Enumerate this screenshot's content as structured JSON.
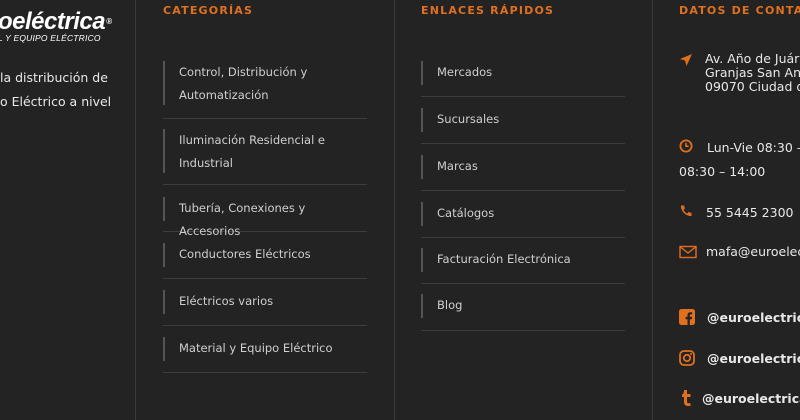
{
  "brand": {
    "logo_text": "oeléctrica",
    "logo_mark": "®",
    "tagline": "L Y EQUIPO ELÉCTRICO",
    "description": "la distribución de o Eléctrico a nivel"
  },
  "categories": {
    "heading": "CATEGORÍAS",
    "items": [
      {
        "label": "Control, Distribución y Automatización"
      },
      {
        "label": "Iluminación Residencial e Industrial"
      },
      {
        "label": "Tubería, Conexiones y Accesorios"
      },
      {
        "label": "Conductores Eléctricos"
      },
      {
        "label": "Eléctricos varios"
      },
      {
        "label": "Material y Equipo Eléctrico"
      }
    ]
  },
  "quick_links": {
    "heading": "ENLACES RÁPIDOS",
    "items": [
      {
        "label": "Mercados"
      },
      {
        "label": "Sucursales"
      },
      {
        "label": "Marcas"
      },
      {
        "label": "Catálogos"
      },
      {
        "label": "Facturación Electrónica"
      },
      {
        "label": "Blog"
      }
    ]
  },
  "contact": {
    "heading": "DATOS DE CONTACTO",
    "address_line1": "Av. Año de Juár",
    "address_line2": "Granjas San An",
    "address_line3": "09070 Ciudad d",
    "hours_line1": "Lun-Vie 08:30 –",
    "hours_line2": "08:30 – 14:00",
    "phone": "55 5445 2300",
    "email": "mafa@euroelec",
    "facebook": "@euroelectrica",
    "instagram": "@euroelectrica",
    "tumblr": "@euroelectrica"
  },
  "colors": {
    "accent": "#e0701e",
    "background": "#232323",
    "divider": "#3a3a3a"
  }
}
